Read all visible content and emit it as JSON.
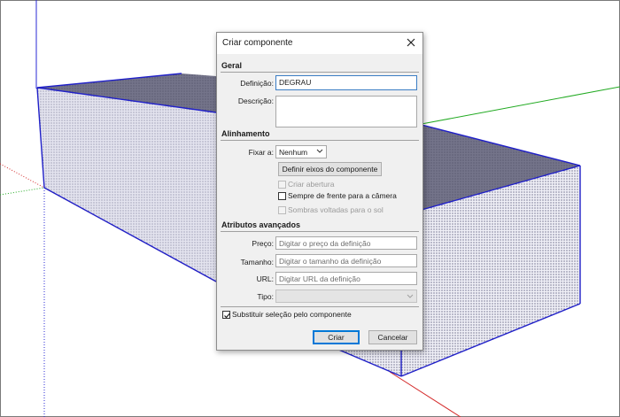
{
  "dialog": {
    "title": "Criar componente",
    "close_icon": "close-icon"
  },
  "geral": {
    "heading": "Geral",
    "definicao_label": "Definição:",
    "definicao_value": "DEGRAU",
    "descricao_label": "Descrição:",
    "descricao_value": ""
  },
  "alinhamento": {
    "heading": "Alinhamento",
    "fixar_label": "Fixar a:",
    "fixar_value": "Nenhum",
    "definir_eixos_label": "Definir eixos do componente",
    "criar_abertura_label": "Criar abertura",
    "criar_abertura_checked": false,
    "sempre_frente_label": "Sempre de frente para a câmera",
    "sempre_frente_checked": false,
    "sombras_label": "Sombras voltadas para o sol",
    "sombras_checked": false
  },
  "avancados": {
    "heading": "Atributos avançados",
    "preco_label": "Preço:",
    "preco_placeholder": "Digitar o preço da definição",
    "tamanho_label": "Tamanho:",
    "tamanho_placeholder": "Digitar o tamanho da definição",
    "url_label": "URL:",
    "url_placeholder": "Digitar URL da definição",
    "tipo_label": "Tipo:",
    "tipo_value": ""
  },
  "footer": {
    "substituir_label": "Substituir seleção pelo componente",
    "substituir_checked": true,
    "criar_label": "Criar",
    "cancelar_label": "Cancelar"
  },
  "colors": {
    "axis_red": "#d42a2a",
    "axis_green": "#22aa22",
    "axis_blue": "#2a2ad4",
    "face_top": "#6c6c82",
    "face_side": "#d8d8e8",
    "accent": "#0078d7"
  }
}
